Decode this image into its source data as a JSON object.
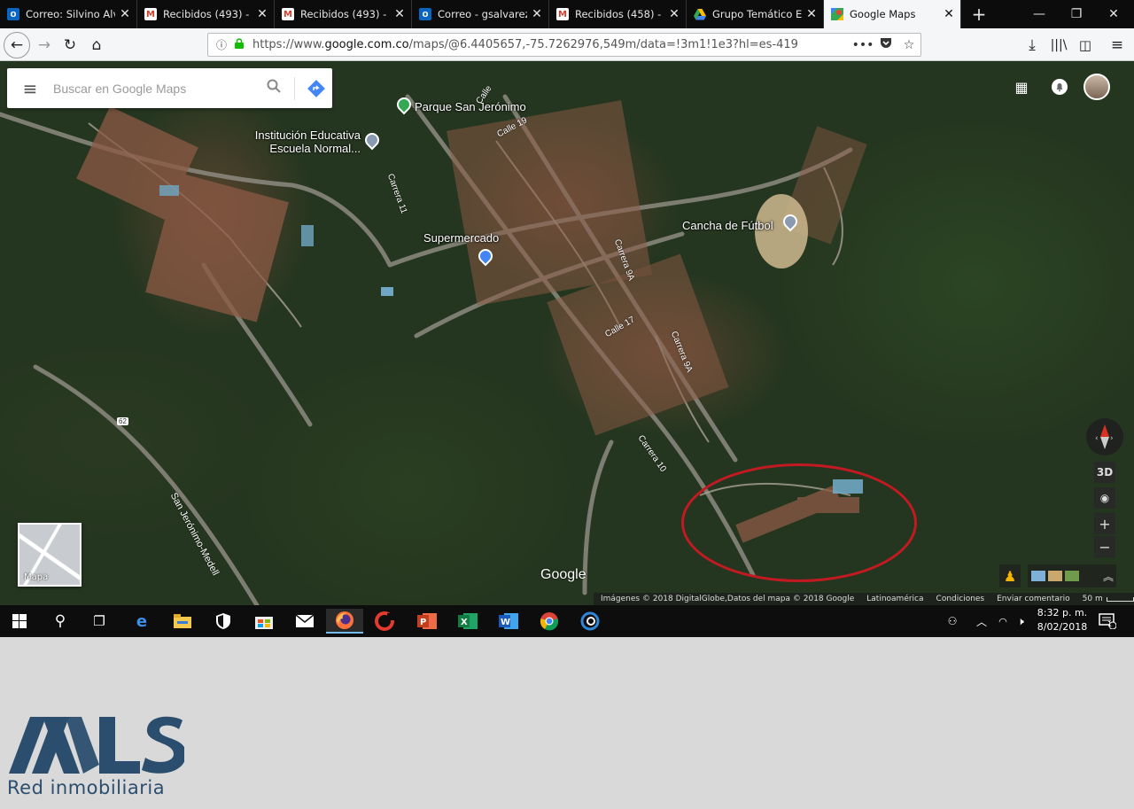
{
  "browser": {
    "tabs": [
      {
        "title": "Correo: Silvino Alva",
        "icon": "outlook-icon"
      },
      {
        "title": "Recibidos (493) - ge",
        "icon": "gmail-icon"
      },
      {
        "title": "Recibidos (493) - ge",
        "icon": "gmail-icon"
      },
      {
        "title": "Correo - gsalvarez@",
        "icon": "outlook-icon"
      },
      {
        "title": "Recibidos (458) - gs",
        "icon": "gmail-icon"
      },
      {
        "title": "Grupo Temático Ele",
        "icon": "drive-icon"
      },
      {
        "title": "Google Maps",
        "icon": "maps-icon",
        "active": true
      }
    ],
    "url_prefix": "https://www.",
    "url_domain": "google.com.co",
    "url_path": "/maps/@6.4405657,-75.7262976,549m/data=!3m1!1e3?hl=es-419"
  },
  "map": {
    "search_placeholder": "Buscar en Google Maps",
    "places": {
      "park": "Parque San Jerónimo",
      "school_line1": "Institución Educativa",
      "school_line2": "Escuela Normal...",
      "supermarket": "Supermercado",
      "field": "Cancha de Fútbol"
    },
    "streets": {
      "calle19": "Calle 19",
      "calle_top": "Calle",
      "carrera11": "Carrera 11",
      "carrera9a_1": "Carrera 9A",
      "carrera9a_2": "Carrera 9A",
      "calle17": "Calle 17",
      "carrera10": "Carrera 10",
      "highway": "San Jerónimo-Medell",
      "route_number": "62"
    },
    "minimap_label": "Mapa",
    "view_3d": "3D",
    "google_logo": "Google",
    "attribution": {
      "imagery": "Imágenes © 2018 DigitalGlobe,Datos del mapa © 2018 Google",
      "region": "Latinoamérica",
      "terms": "Condiciones",
      "feedback": "Enviar comentario",
      "scale": "50 m"
    },
    "colors": {
      "highlight_circle": "#c31a22",
      "pin_green": "#34a853",
      "pin_blue": "#4285f4",
      "pin_gray": "#8a9ab0"
    }
  },
  "taskbar": {
    "clock_time": "8:32 p. m.",
    "clock_date": "8/02/2018",
    "notification_count": "1"
  },
  "logo": {
    "wordmark": "MLS",
    "caption": "Red inmobiliaria",
    "color": "#2b4e6e"
  }
}
